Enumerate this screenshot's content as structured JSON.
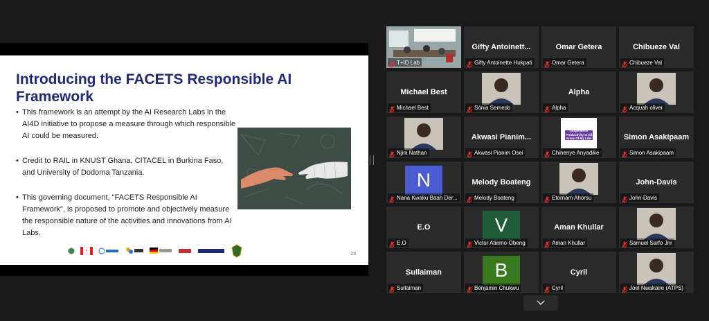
{
  "slide": {
    "title": "Introducing the FACETS Responsible AI Framework",
    "bullets": [
      "This framework is an attempt by the AI Research Labs in the AI4D  initiative to propose a measure through which responsible AI could be measured.",
      "Credit to RAIL in KNUST Ghana, CITACEL in Burkina Faso, and University of Dodoma Tanzania.",
      "This governing document, \"FACETS Responsible AI Framework\", is proposed to promote and objectively measure the responsible nature of the activities and innovations from AI Labs."
    ],
    "bullet_symbol": "•",
    "page_number": "23",
    "image_desc": "human-and-robot-hands-icon",
    "logos": [
      "ARTIFICIAL INTELLIGENCE FOR DEVELOPMENT AFRICA",
      "Canada",
      "IDRC · CRDI",
      "Sida",
      "German Cooperation",
      "giz",
      "FAIR FORWARD",
      "crest"
    ]
  },
  "participants": [
    {
      "display": "T+ID Lab",
      "label": "T+ID Lab",
      "type": "video",
      "active": true
    },
    {
      "display": "Gifty  Antoinett...",
      "label": "Gifty Antoinette Hukpati",
      "type": "name"
    },
    {
      "display": "Omar Getera",
      "label": "Omar Getera",
      "type": "name"
    },
    {
      "display": "Chibueze Val",
      "label": "Chibueze Val",
      "type": "name"
    },
    {
      "display": "Michael Best",
      "label": "Michael Best",
      "type": "name"
    },
    {
      "display": "",
      "label": "Sónia Semedo",
      "type": "video"
    },
    {
      "display": "Alpha",
      "label": "Alpha",
      "type": "name"
    },
    {
      "display": "",
      "label": "Acquah oliver",
      "type": "video"
    },
    {
      "display": "",
      "label": "Njini Nathan",
      "type": "video"
    },
    {
      "display": "Akwasi  Pianim...",
      "label": "Akwasi Pianim Osei",
      "type": "name"
    },
    {
      "display": "",
      "label": "Chinenye Anyadike",
      "type": "video",
      "poster_text": "I Experience Productivity In All Areas Of My Life!"
    },
    {
      "display": "Simon Asakipaam",
      "label": "Simon Asakipaam",
      "type": "name"
    },
    {
      "display": "N",
      "label": "Nana Kwaku Baah Der...",
      "type": "letter",
      "color": "#4a5cd0"
    },
    {
      "display": "Melody Boateng",
      "label": "Melody Boateng",
      "type": "name"
    },
    {
      "display": "",
      "label": "Etornam Ahorsu",
      "type": "video"
    },
    {
      "display": "John-Davis",
      "label": "John-Davis",
      "type": "name"
    },
    {
      "display": "E.O",
      "label": "E.O",
      "type": "name"
    },
    {
      "display": "V",
      "label": "Victor Atiemo-Obeng",
      "type": "letter",
      "color": "#1f5c3a"
    },
    {
      "display": "Aman Khullar",
      "label": "Aman Khullar",
      "type": "name"
    },
    {
      "display": "",
      "label": "Samuel Sarfo Jnr",
      "type": "video"
    },
    {
      "display": "Sullaiman",
      "label": "Sullaiman",
      "type": "name"
    },
    {
      "display": "B",
      "label": "Benjamin Chukwu",
      "type": "letter",
      "color": "#3a7a1e"
    },
    {
      "display": "Cyril",
      "label": "Cyril",
      "type": "name"
    },
    {
      "display": "",
      "label": "Joel Nwakaire (ATPS)",
      "type": "video"
    }
  ],
  "icons": {
    "muted": "muted-mic-icon",
    "more": "chevron-down-icon"
  },
  "colors": {
    "title": "#1e2a78",
    "muted": "#e0312a",
    "active_border": "#c8d14a",
    "tile_bg": "#2b2b2b"
  }
}
